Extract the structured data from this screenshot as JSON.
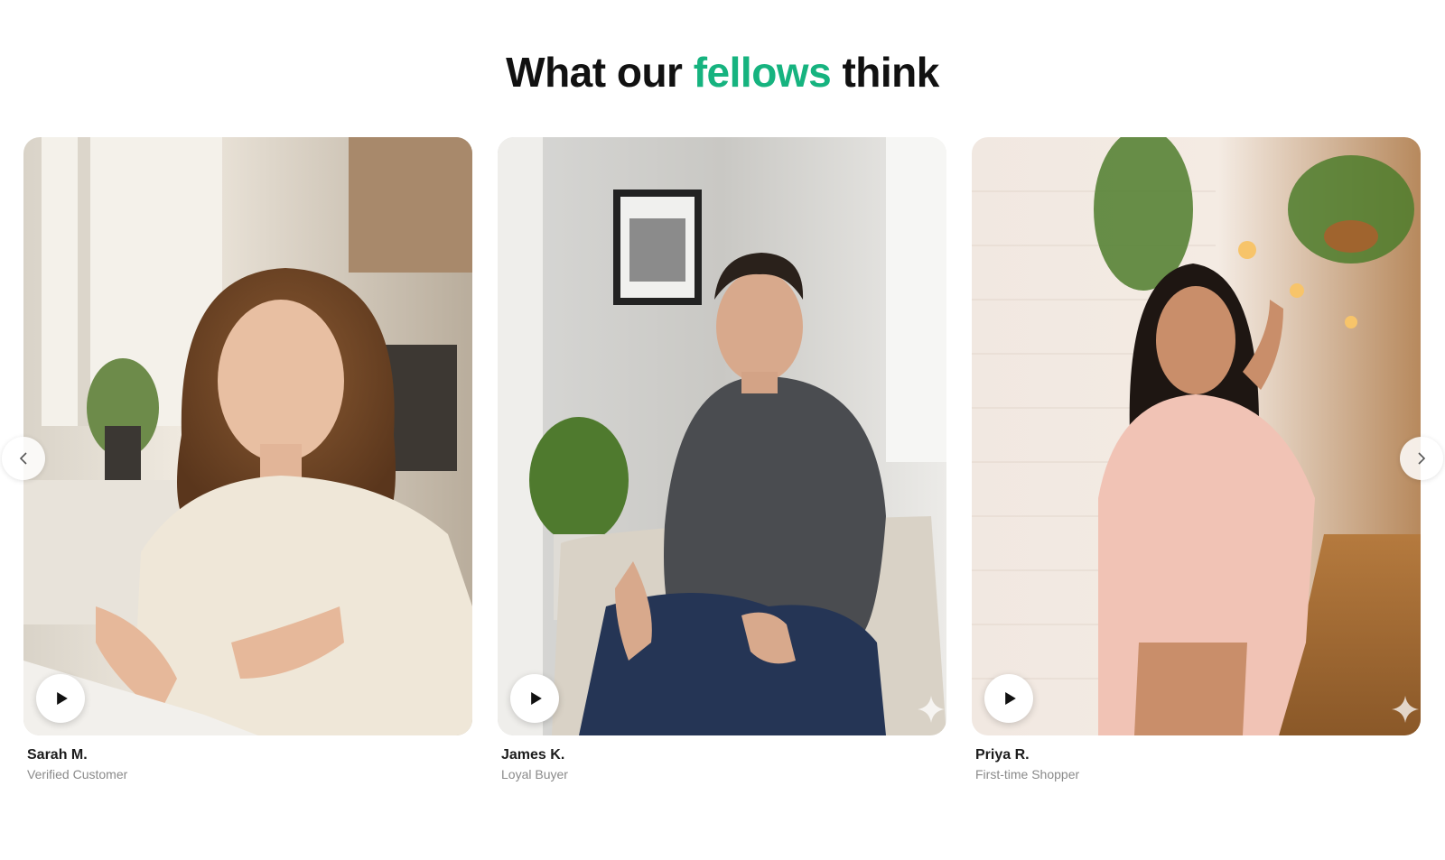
{
  "heading": {
    "prefix": "What our ",
    "accent": "fellows",
    "suffix": " think",
    "accent_color": "#16b37f"
  },
  "carousel": {
    "prev_icon": "chevron-left-icon",
    "next_icon": "chevron-right-icon",
    "cards": [
      {
        "name": "Sarah M.",
        "role": "Verified Customer",
        "play_icon": "play-icon"
      },
      {
        "name": "James K.",
        "role": "Loyal Buyer",
        "play_icon": "play-icon",
        "badge_icon": "sparkle-icon"
      },
      {
        "name": "Priya R.",
        "role": "First-time Shopper",
        "play_icon": "play-icon",
        "badge_icon": "sparkle-icon"
      }
    ]
  }
}
